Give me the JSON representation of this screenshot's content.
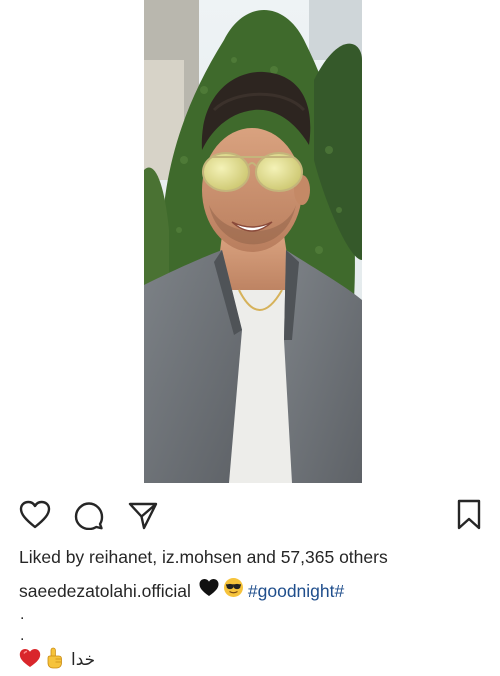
{
  "post": {
    "photo": {
      "icon": "selfie-photo"
    },
    "actions": {
      "like_icon": "heart-outline-icon",
      "comment_icon": "comment-bubble-icon",
      "share_icon": "paper-plane-icon",
      "save_icon": "bookmark-icon"
    },
    "likes_text": "Liked by reihanet, iz.mohsen and 57,365 others",
    "caption": {
      "username": "saeedezatolahi.official",
      "emoji_1": "black-heart",
      "emoji_2": "sunglasses-face",
      "hashtag": "#goodnight#"
    },
    "dots": [
      ".",
      "."
    ],
    "last_line": {
      "emoji_1": "red-heart",
      "emoji_2": "index-pointing-up",
      "text": "خدا"
    },
    "colors": {
      "text": "#262626",
      "hashtag": "#1f4e8c",
      "red_heart": "#d9262b",
      "black_heart": "#111111",
      "emoji_yellow": "#f6c33b"
    }
  }
}
